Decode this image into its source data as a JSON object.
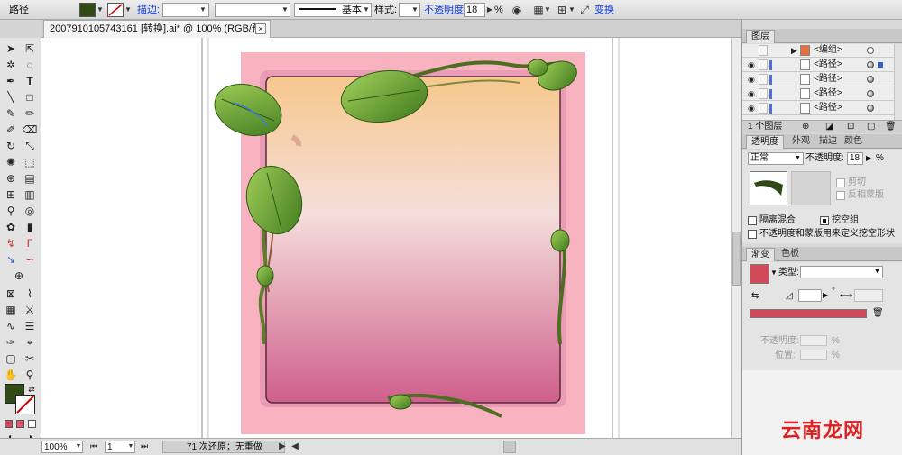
{
  "control_bar": {
    "object_type": "路径",
    "fill_color": "#2f4a14",
    "stroke_label": "描边:",
    "stroke_weight": "",
    "brush_label": "基本",
    "style_label": "样式:",
    "opacity_label": "不透明度:",
    "opacity_value": "18",
    "opacity_unit": "%",
    "transform_label": "变换"
  },
  "document": {
    "tab_title": "2007910105743161 [转换].ai* @ 100% (RGB/预览)",
    "close_glyph": "×"
  },
  "status_bar": {
    "zoom": "100%",
    "page": "1",
    "undo_status": "71 次还原；无重做"
  },
  "layers_panel": {
    "tab": "图层",
    "rows": [
      {
        "name": "<编组>",
        "has_eye": false
      },
      {
        "name": "<路径>",
        "has_eye": true
      },
      {
        "name": "<路径>",
        "has_eye": true
      },
      {
        "name": "<路径>",
        "has_eye": true
      },
      {
        "name": "<路径>",
        "has_eye": true
      }
    ],
    "footer": "1 个图层"
  },
  "transparency_panel": {
    "tabs": [
      "透明度",
      "外观",
      "描边",
      "颜色"
    ],
    "blend_mode": "正常",
    "opacity_label": "不透明度:",
    "opacity_value": "18",
    "opacity_unit": "%",
    "clip_label": "剪切",
    "invert_mask_label": "反相蒙版",
    "isolate_blend_label": "隔离混合",
    "knockout_label": "挖空组",
    "opacity_mask_label": "不透明度和蒙版用来定义挖空形状"
  },
  "gradient_panel": {
    "tabs": [
      "渐变",
      "色板"
    ],
    "type_label": "类型:",
    "type_value": "",
    "angle_unit": "°",
    "opacity_label": "不透明度:",
    "opacity_unit": "%",
    "position_label": "位置:",
    "position_unit": "%",
    "gradient_color": "#d04a5a"
  },
  "watermark": "云南龙网",
  "colors": {
    "fill": "#2f4a14",
    "artboard_pink": "#f9b3c0",
    "frame_top": "#f7c88c",
    "frame_bottom": "#cf5f8c",
    "leaf": "#6aa22e"
  }
}
